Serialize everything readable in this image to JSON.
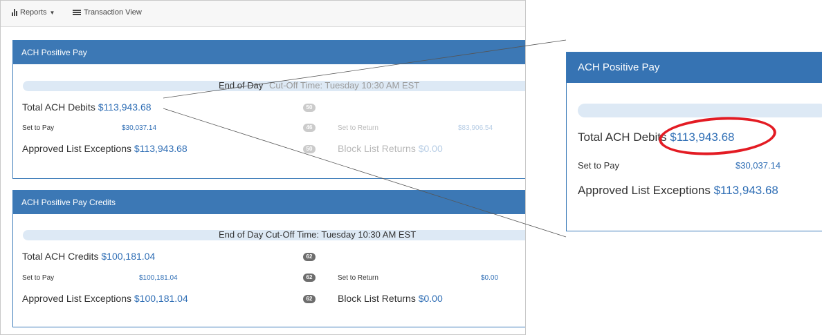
{
  "toolbar": {
    "reports_label": "Reports",
    "transaction_view_label": "Transaction View"
  },
  "debits_panel": {
    "title": "ACH Positive Pay",
    "cutoff_prefix": "End of Day",
    "cutoff_suffix": "Cut-Off Time: Tuesday 10:30 AM EST",
    "total_label": "Total ACH Debits",
    "total_value": "$113,943.68",
    "total_badge": "50",
    "set_to_pay_label": "Set to Pay",
    "set_to_pay_value": "$30,037.14",
    "set_to_pay_badge": "46",
    "set_to_return_label": "Set to Return",
    "set_to_return_value": "$83,906.54",
    "approved_label": "Approved List Exceptions",
    "approved_value": "$113,943.68",
    "approved_badge": "50",
    "block_label": "Block List Returns",
    "block_value": "$0.00"
  },
  "credits_panel": {
    "title": "ACH Positive Pay Credits",
    "cutoff": "End of Day Cut-Off Time: Tuesday 10:30 AM EST",
    "total_label": "Total ACH Credits",
    "total_value": "$100,181.04",
    "total_badge": "62",
    "set_to_pay_label": "Set to Pay",
    "set_to_pay_value": "$100,181.04",
    "set_to_pay_badge": "62",
    "set_to_return_label": "Set to Return",
    "set_to_return_value": "$0.00",
    "approved_label": "Approved List Exceptions",
    "approved_value": "$100,181.04",
    "approved_badge": "62",
    "block_label": "Block List Returns",
    "block_value": "$0.00"
  },
  "zoom_callout": {
    "title": "ACH Positive Pay",
    "total_label": "Total ACH Debits",
    "total_value": "$113,943.68",
    "set_to_pay_label": "Set to Pay",
    "set_to_pay_value": "$30,037.14",
    "approved_label": "Approved List Exceptions",
    "approved_value": "$113,943.68"
  },
  "colors": {
    "panel_header": "#3c78b5",
    "link_value": "#2f6eb5",
    "highlight_ring": "#e31b23",
    "badge": "#6d6d6d"
  }
}
